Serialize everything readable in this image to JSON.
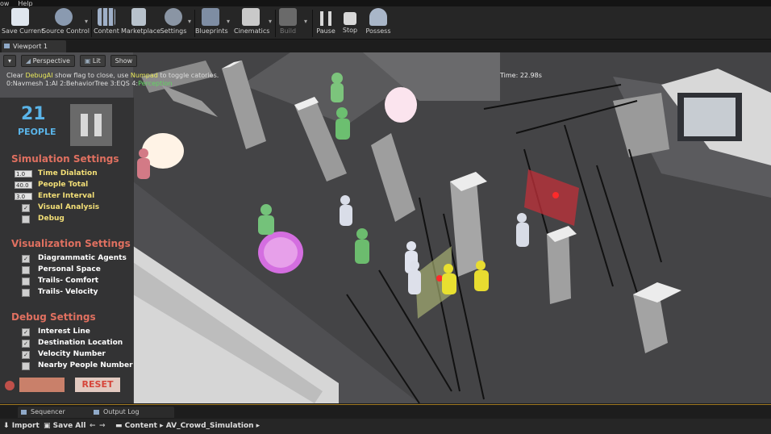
{
  "menu": {
    "items": [
      "ow",
      "Help"
    ]
  },
  "toolbar": {
    "save_current": "Save Current",
    "source_control": "Source Control",
    "content": "Content",
    "marketplace": "Marketplace",
    "settings": "Settings",
    "blueprints": "Blueprints",
    "cinematics": "Cinematics",
    "build": "Build",
    "pause": "Pause",
    "stop": "Stop",
    "possess": "Possess"
  },
  "viewport_tab": "Viewport 1",
  "viewport": {
    "perspective": "Perspective",
    "lit": "Lit",
    "show": "Show",
    "debug_pre": "Clear ",
    "debug_ai": "DebugAI",
    "debug_mid": " show flag to close, use ",
    "numpad": "Numpad",
    "debug_post": " to toggle catories.",
    "cat_plain": "0:Navmesh 1:AI 2:BehaviorTree 3:EQS 4:",
    "cat_green": "Perception",
    "time": "Time: 22.98s"
  },
  "panel": {
    "count": "21",
    "people_label": "PEOPLE",
    "sim_title": "Simulation Settings",
    "time_dialation_val": "1.0",
    "time_dialation": "Time Dialation",
    "people_total_val": "40.0",
    "people_total": "People Total",
    "enter_interval_val": "3.0",
    "enter_interval": "Enter Interval",
    "visual_analysis": "Visual Analysis",
    "debug": "Debug",
    "vis_title": "Visualization Settings",
    "diagrammatic": "Diagrammatic Agents",
    "personal_space": "Personal Space",
    "trails_comfort": "Trails- Comfort",
    "trails_velocity": "Trails- Velocity",
    "debug_title": "Debug Settings",
    "interest_line": "Interest Line",
    "destination": "Destination Location",
    "velocity_number": "Velocity Number",
    "nearby": "Nearby People Number",
    "reset": "RESET"
  },
  "bottom_tabs": {
    "sequencer": "Sequencer",
    "output_log": "Output Log"
  },
  "status": {
    "import": "Import",
    "save_all": "Save All",
    "content": "Content",
    "folder": "AV_Crowd_Simulation"
  },
  "colors": {
    "accent_title": "#e07060",
    "people_blue": "#5ab4e8",
    "option_yellow": "#f3df77"
  }
}
